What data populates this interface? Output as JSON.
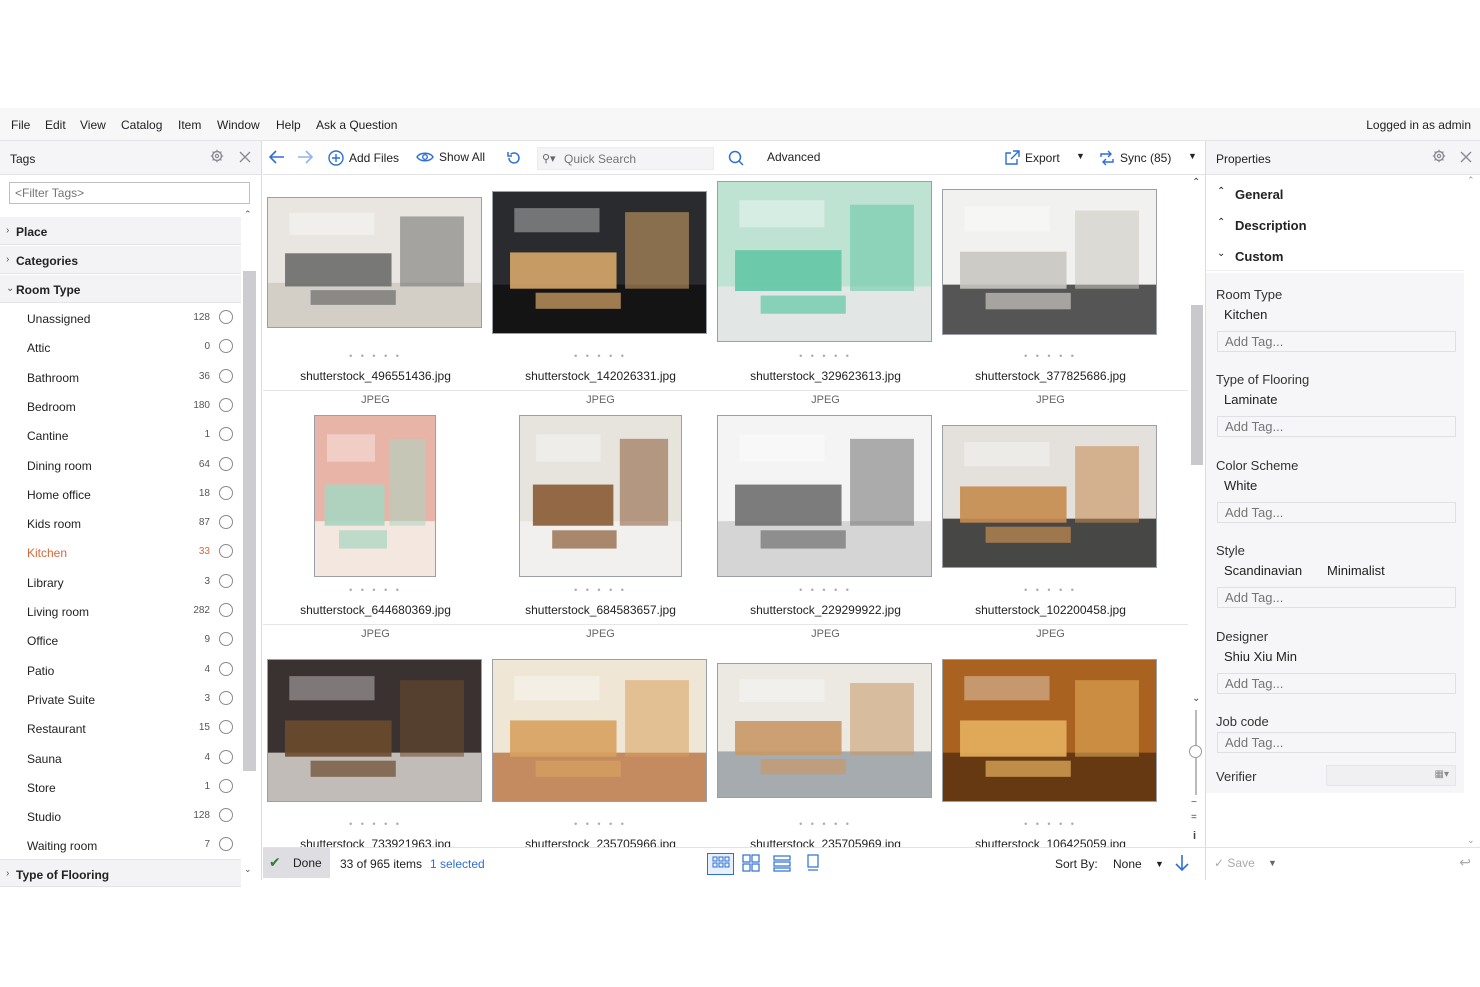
{
  "menu": [
    "File",
    "Edit",
    "View",
    "Catalog",
    "Item",
    "Window",
    "Help",
    "Ask a Question"
  ],
  "logged_in": "Logged in as admin",
  "tags_panel": {
    "title": "Tags",
    "filter_placeholder": "<Filter Tags>",
    "groups": {
      "place": "Place",
      "categories": "Categories",
      "room_type": "Room Type",
      "type_of_flooring": "Type of Flooring"
    },
    "room_types": [
      {
        "name": "Unassigned",
        "count": "128"
      },
      {
        "name": "Attic",
        "count": "0"
      },
      {
        "name": "Bathroom",
        "count": "36"
      },
      {
        "name": "Bedroom",
        "count": "180"
      },
      {
        "name": "Cantine",
        "count": "1"
      },
      {
        "name": "Dining room",
        "count": "64"
      },
      {
        "name": "Home office",
        "count": "18"
      },
      {
        "name": "Kids room",
        "count": "87"
      },
      {
        "name": "Kitchen",
        "count": "33"
      },
      {
        "name": "Library",
        "count": "3"
      },
      {
        "name": "Living room",
        "count": "282"
      },
      {
        "name": "Office",
        "count": "9"
      },
      {
        "name": "Patio",
        "count": "4"
      },
      {
        "name": "Private Suite",
        "count": "3"
      },
      {
        "name": "Restaurant",
        "count": "15"
      },
      {
        "name": "Sauna",
        "count": "4"
      },
      {
        "name": "Store",
        "count": "1"
      },
      {
        "name": "Studio",
        "count": "128"
      },
      {
        "name": "Waiting room",
        "count": "7"
      }
    ],
    "active_room_type": "Kitchen"
  },
  "toolbar": {
    "add_files": "Add Files",
    "show_all": "Show All",
    "search_placeholder": "Quick Search",
    "advanced": "Advanced",
    "export": "Export",
    "sync": "Sync (85)"
  },
  "items": [
    {
      "filename": "shutterstock_496551436.jpg",
      "type": "JPEG"
    },
    {
      "filename": "shutterstock_142026331.jpg",
      "type": "JPEG"
    },
    {
      "filename": "shutterstock_329623613.jpg",
      "type": "JPEG"
    },
    {
      "filename": "shutterstock_377825686.jpg",
      "type": "JPEG"
    },
    {
      "filename": "shutterstock_644680369.jpg",
      "type": "JPEG"
    },
    {
      "filename": "shutterstock_684583657.jpg",
      "type": "JPEG"
    },
    {
      "filename": "shutterstock_229299922.jpg",
      "type": "JPEG"
    },
    {
      "filename": "shutterstock_102200458.jpg",
      "type": "JPEG"
    },
    {
      "filename": "shutterstock_733921963.jpg",
      "type": ""
    },
    {
      "filename": "shutterstock_235705966.jpg",
      "type": ""
    },
    {
      "filename": "shutterstock_235705969.jpg",
      "type": ""
    },
    {
      "filename": "shutterstock_106425059.jpg",
      "type": ""
    }
  ],
  "status": {
    "done": "Done",
    "count": "33 of 965 items",
    "selected": "1 selected",
    "sort_by_label": "Sort By:",
    "sort_by_value": "None"
  },
  "properties": {
    "title": "Properties",
    "sections": {
      "general": "General",
      "description": "Description",
      "custom": "Custom"
    },
    "add_tag_placeholder": "Add Tag...",
    "fields": {
      "room_type": {
        "label": "Room Type",
        "values": [
          "Kitchen"
        ]
      },
      "flooring": {
        "label": "Type of Flooring",
        "values": [
          "Laminate"
        ]
      },
      "color_scheme": {
        "label": "Color Scheme",
        "values": [
          "White"
        ]
      },
      "style": {
        "label": "Style",
        "values": [
          "Scandinavian",
          "Minimalist"
        ]
      },
      "designer": {
        "label": "Designer",
        "values": [
          "Shiu Xiu Min"
        ]
      },
      "job_code": {
        "label": "Job code",
        "values": []
      },
      "verifier": {
        "label": "Verifier",
        "values": []
      }
    },
    "save": "Save"
  },
  "colors": {
    "accent": "#2d6fd6",
    "active_tag": "#d4683a",
    "done_check": "#2e7d32"
  }
}
